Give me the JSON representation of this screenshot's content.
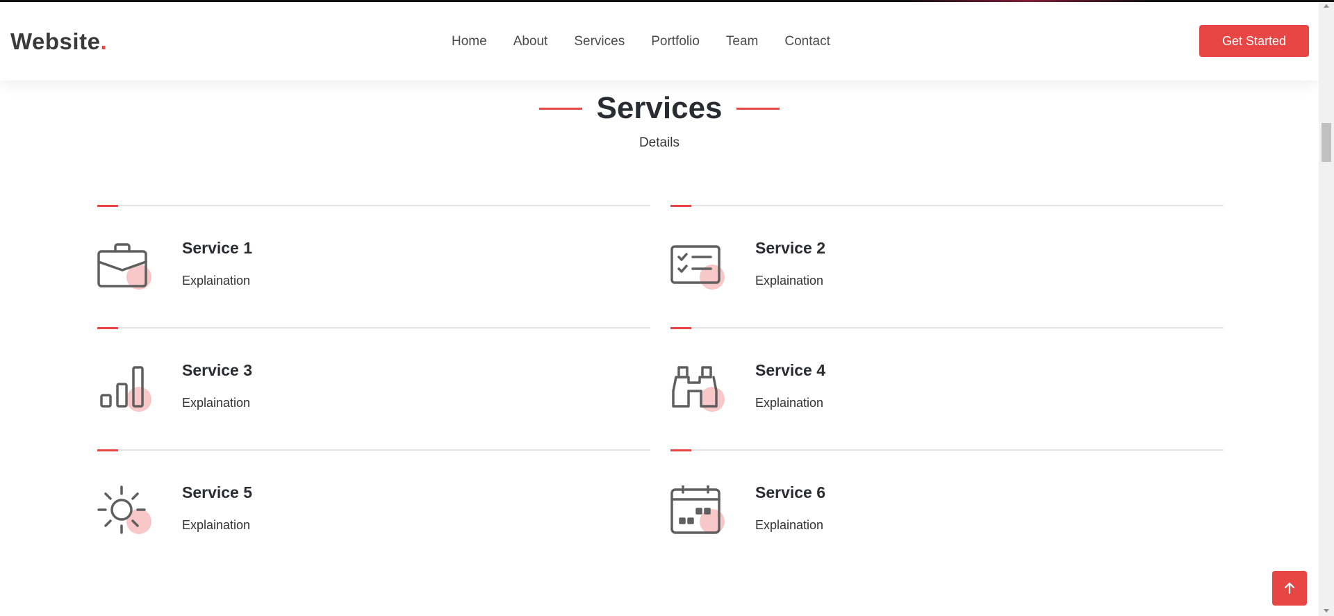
{
  "header": {
    "logo_text": "Website",
    "logo_dot": ".",
    "nav": [
      {
        "label": "Home"
      },
      {
        "label": "About"
      },
      {
        "label": "Services"
      },
      {
        "label": "Portfolio"
      },
      {
        "label": "Team"
      },
      {
        "label": "Contact"
      }
    ],
    "cta_label": "Get Started"
  },
  "section": {
    "title": "Services",
    "subtitle": "Details"
  },
  "services": [
    {
      "title": "Service 1",
      "text": "Explaination",
      "icon": "briefcase-icon"
    },
    {
      "title": "Service 2",
      "text": "Explaination",
      "icon": "checklist-icon"
    },
    {
      "title": "Service 3",
      "text": "Explaination",
      "icon": "bar-chart-icon"
    },
    {
      "title": "Service 4",
      "text": "Explaination",
      "icon": "binoculars-icon"
    },
    {
      "title": "Service 5",
      "text": "Explaination",
      "icon": "sun-icon"
    },
    {
      "title": "Service 6",
      "text": "Explaination",
      "icon": "calendar-icon"
    }
  ],
  "colors": {
    "accent": "#e84545",
    "heading": "#2b2b33",
    "text": "#333333",
    "icon": "#5f5f5f"
  },
  "back_to_top_icon": "arrow-up-icon"
}
